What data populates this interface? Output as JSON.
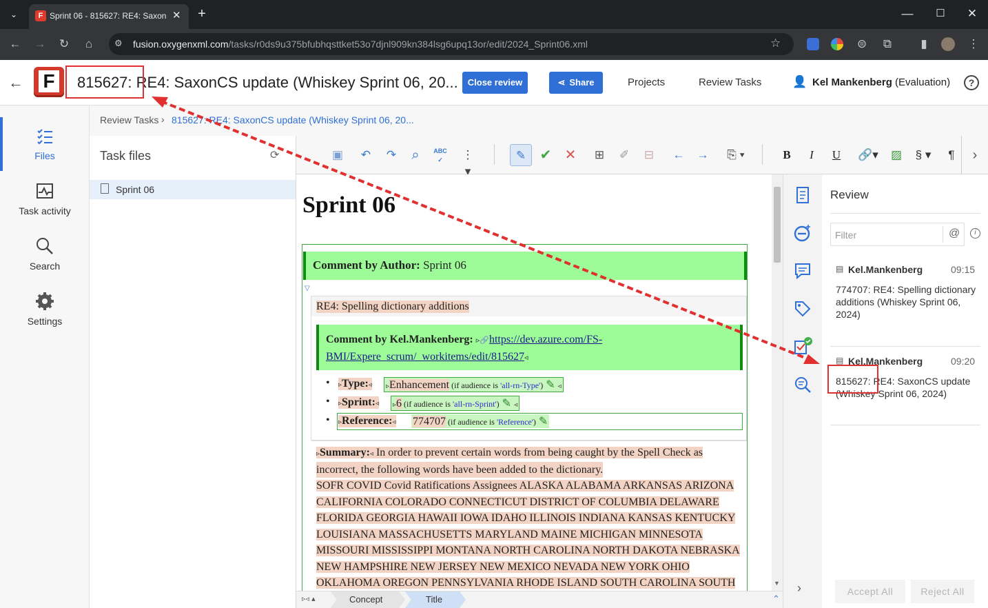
{
  "browser": {
    "tab_title": "Sprint 06 - 815627: RE4: Saxon",
    "url_host": "fusion.oxygenxml.com",
    "url_path": "/tasks/r0ds9u375bfubhqsttket53o7djnl909kn384lsg6upq13or/edit/2024_Sprint06.xml"
  },
  "header": {
    "logo_letter": "F",
    "title": "815627: RE4: SaxonCS update (Whiskey Sprint 06, 20...",
    "close_review": "Close review",
    "share": "Share",
    "projects": "Projects",
    "review_tasks": "Review Tasks",
    "user_name": "Kel Mankenberg",
    "user_note": "(Evaluation)"
  },
  "nav": {
    "files": "Files",
    "task_activity": "Task activity",
    "search": "Search",
    "settings": "Settings"
  },
  "breadcrumb": {
    "root": "Review Tasks",
    "current": "815627: RE4: SaxonCS update (Whiskey Sprint 06, 20..."
  },
  "task_files": {
    "heading": "Task files",
    "items": [
      "Sprint 06"
    ]
  },
  "doc": {
    "title": "Sprint 06",
    "comment_author_label": "Comment by Author:",
    "comment_author_text": "Sprint 06",
    "section_title": "RE4: Spelling dictionary additions",
    "comment_kel_label": "Comment by Kel.Mankenberg:",
    "comment_kel_link1": "https://dev.azure.com/FS-",
    "comment_kel_link2": "BMI/Expere_scrum/_workitems/edit/815627",
    "type_label": "Type:",
    "type_value": "Enhancement",
    "type_cond_prefix": "(if audience is",
    "type_cond_value": "'all-rn-Type'",
    "type_cond_suffix": ")",
    "sprint_label": "Sprint:",
    "sprint_value": "6",
    "sprint_cond_prefix": "(if audience is",
    "sprint_cond_value": "'all-rn-Sprint'",
    "sprint_cond_suffix": ")",
    "ref_label": "Reference:",
    "ref_value": "774707",
    "ref_cond_prefix": "(if audience is",
    "ref_cond_value": "'Reference'",
    "ref_cond_suffix": ")",
    "summary_label": "Summary:",
    "summary_line1": "In order to prevent certain words from being caught by the Spell Check as",
    "summary_line2": "incorrect, the following words have been added to the dictionary.",
    "words": [
      "SOFR COVID Covid Ratifications Assignees ALASKA ALABAMA ARKANSAS ARIZONA",
      "CALIFORNIA COLORADO CONNECTICUT DISTRICT OF COLUMBIA DELAWARE",
      "FLORIDA GEORGIA HAWAII IOWA IDAHO ILLINOIS INDIANA KANSAS KENTUCKY",
      "LOUISIANA MASSACHUSETTS MARYLAND MAINE MICHIGAN MINNESOTA",
      "MISSOURI MISSISSIPPI MONTANA NORTH CAROLINA NORTH DAKOTA NEBRASKA",
      "NEW HAMPSHIRE NEW JERSEY NEW MEXICO NEVADA NEW YORK OHIO",
      "OKLAHOMA OREGON PENNSYLVANIA RHODE ISLAND SOUTH CAROLINA SOUTH"
    ]
  },
  "bottom_tabs": [
    "Concept",
    "Title"
  ],
  "review": {
    "heading": "Review",
    "filter_placeholder": "Filter",
    "comments": [
      {
        "author": "Kel.Mankenberg",
        "time": "09:15",
        "text": "774707: RE4: Spelling dictionary additions (Whiskey Sprint 06, 2024)"
      },
      {
        "author": "Kel.Mankenberg",
        "time": "09:20",
        "text": "815627: RE4: SaxonCS update (Whiskey Sprint 06, 2024)"
      }
    ],
    "accept_all": "Accept All",
    "reject_all": "Reject All"
  },
  "colors": {
    "accent": "#2f6fd6",
    "comment_bg": "#9dfc98",
    "highlight": "#f3d4c4",
    "annotation_red": "#e03030"
  }
}
